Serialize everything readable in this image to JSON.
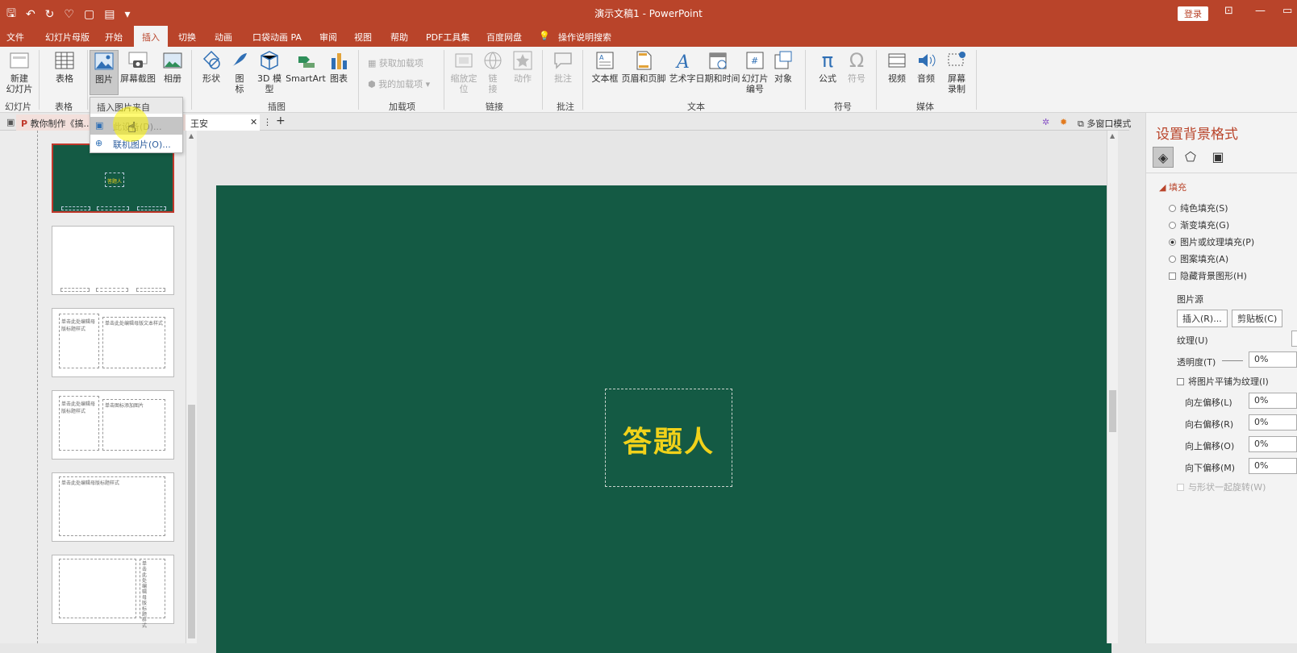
{
  "app": {
    "title": "演示文稿1 - PowerPoint",
    "login": "登录"
  },
  "tabs": [
    "文件",
    "幻灯片母版",
    "开始",
    "插入",
    "切换",
    "动画",
    "口袋动画 PA",
    "审阅",
    "视图",
    "帮助",
    "PDF工具集",
    "百度网盘",
    "操作说明搜索"
  ],
  "ribbon": {
    "new_slide": "新建\n幻灯片",
    "group_slides": "幻灯片",
    "table": "表格",
    "group_table": "表格",
    "picture": "图片",
    "screenshot": "屏幕截图",
    "album": "相册",
    "shapes": "形状",
    "icons": "图\n标",
    "model3d": "3D 模\n型",
    "smartart": "SmartArt",
    "chart": "图表",
    "group_illustrations": "插图",
    "get_addins": "获取加载项",
    "my_addins": "我的加载项",
    "group_addins": "加载项",
    "zoom": "缩放定\n位",
    "link": "链\n接",
    "action": "动作",
    "group_links": "链接",
    "comment": "批注",
    "group_comments": "批注",
    "textbox": "文本框",
    "header_footer": "页眉和页脚",
    "wordart": "艺术字",
    "datetime": "日期和时间",
    "slide_number": "幻灯片\n编号",
    "object": "对象",
    "group_text": "文本",
    "equation": "公式",
    "symbol": "符号",
    "group_symbols": "符号",
    "video": "视频",
    "audio": "音频",
    "screen_record": "屏幕\n录制",
    "group_media": "媒体"
  },
  "dropdown": {
    "header": "插入图片来自",
    "items": [
      "此设备(D)...",
      "联机图片(O)..."
    ]
  },
  "docbar": {
    "tab1": "教你制作《搞...",
    "tab2": "王安",
    "multiwindow": "多窗口模式"
  },
  "slide": {
    "title_text": "答题人"
  },
  "thumbnails": {
    "selected_text": "答题人",
    "t3_left": "单击此处编辑母版标题样式",
    "t3_right": "单击此处编辑母版文本样式",
    "t4_left": "单击此处编辑母版标题样式",
    "t4_right": "单击图标添加图片",
    "t5": "单击此处编辑母版标题样式",
    "t6": "单击此处编辑母版标题样式"
  },
  "pane": {
    "title": "设置背景格式",
    "section": "填充",
    "fill_solid": "纯色填充(S)",
    "fill_gradient": "渐变填充(G)",
    "fill_picture": "图片或纹理填充(P)",
    "fill_pattern": "图案填充(A)",
    "hide_bg": "隐藏背景图形(H)",
    "picture_source": "图片源",
    "insert_btn": "插入(R)...",
    "clipboard_btn": "剪贴板(C)",
    "texture": "纹理(U)",
    "transparency": "透明度(T)",
    "transparency_val": "0%",
    "tile": "将图片平铺为纹理(I)",
    "offset_left": "向左偏移(L)",
    "offset_left_val": "0%",
    "offset_right": "向右偏移(R)",
    "offset_right_val": "0%",
    "offset_top": "向上偏移(O)",
    "offset_top_val": "0%",
    "offset_bottom": "向下偏移(M)",
    "offset_bottom_val": "0%",
    "rotate": "与形状一起旋转(W)"
  }
}
